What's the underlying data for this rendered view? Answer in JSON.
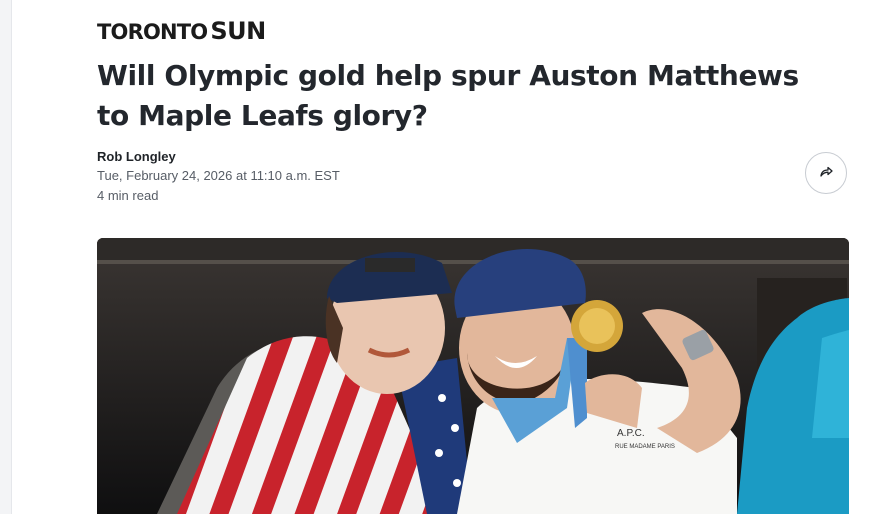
{
  "publisher": {
    "name_part1": "TORONTO",
    "name_part2": "SUN"
  },
  "article": {
    "headline": "Will Olympic gold help spur Auston Matthews to Maple Leafs glory?",
    "author": "Rob Longley",
    "date": "Tue, February 24, 2026 at 11:10 a.m. EST",
    "read_time": "4 min read"
  },
  "share": {
    "icon": "share-arrow-icon"
  },
  "hero_image": {
    "shirt_text_line1": "A.P.C.",
    "shirt_text_line2": "RUE MADAME PARIS"
  },
  "colors": {
    "background": "#ffffff",
    "text": "#23272d",
    "muted": "#575d66",
    "border": "#c8ccd2"
  }
}
